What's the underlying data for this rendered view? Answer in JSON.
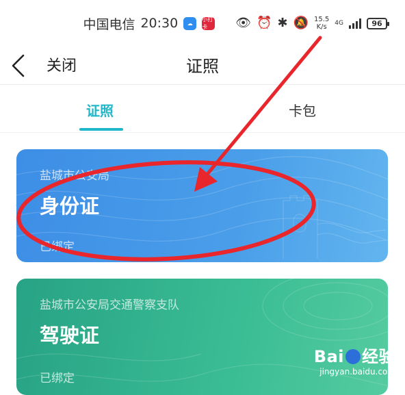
{
  "status_bar": {
    "carrier": "中国电信",
    "time": "20:30",
    "app_badge_label": "小打卡",
    "speed_value": "15.5",
    "speed_unit": "K/s",
    "network": "4G",
    "battery": "96",
    "colors": {
      "weather_app": "#2f8ff0",
      "red_app": "#e0283c"
    }
  },
  "header": {
    "close_label": "关闭",
    "title": "证照"
  },
  "tabs": [
    {
      "label": "证照",
      "active": true
    },
    {
      "label": "卡包",
      "active": false
    }
  ],
  "cards": [
    {
      "issuer": "盐城市公安局",
      "name": "身份证",
      "status": "已绑定",
      "color": "#3d8ee6"
    },
    {
      "issuer": "盐城市公安局交通警察支队",
      "name": "驾驶证",
      "status": "已绑定",
      "color": "#2fae8c"
    }
  ],
  "watermark": {
    "logo_left": "Bai",
    "logo_right": "经验",
    "url": "jingyan.baidu.com"
  },
  "colors": {
    "accent": "#1fb7c9",
    "annotation": "#e8262b"
  }
}
